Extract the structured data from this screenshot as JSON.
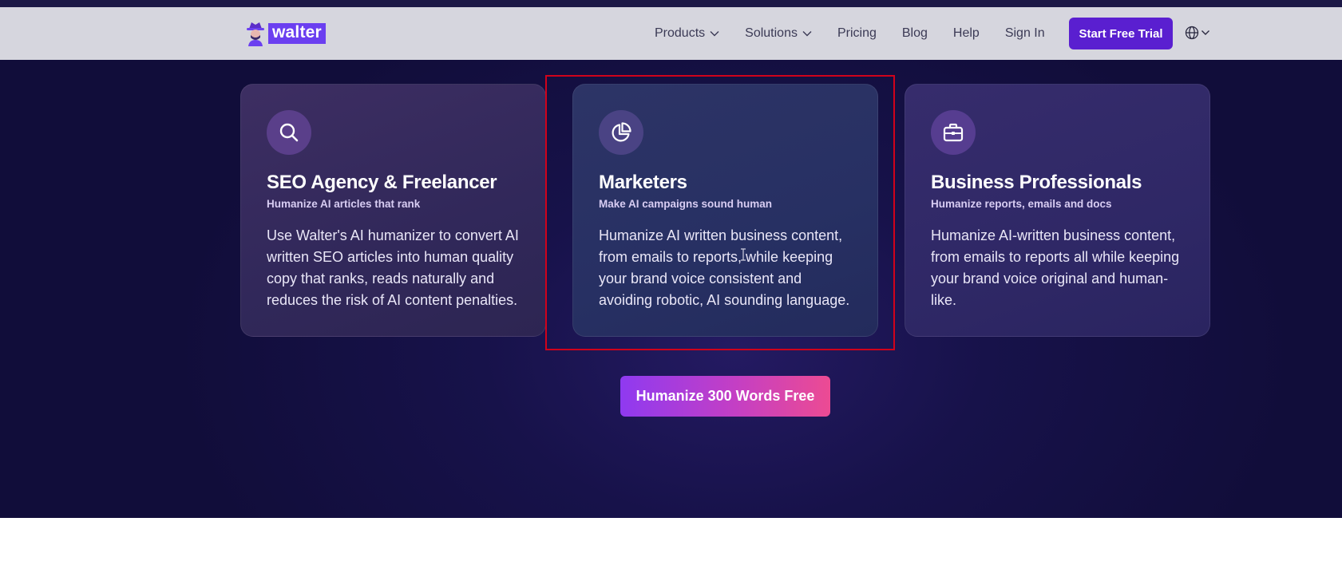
{
  "navbar": {
    "logo_text": "walter",
    "items": [
      {
        "label": "Products",
        "has_dropdown": true
      },
      {
        "label": "Solutions",
        "has_dropdown": true
      },
      {
        "label": "Pricing",
        "has_dropdown": false
      },
      {
        "label": "Blog",
        "has_dropdown": false
      },
      {
        "label": "Help",
        "has_dropdown": false
      },
      {
        "label": "Sign In",
        "has_dropdown": false
      }
    ],
    "cta_label": "Start Free Trial",
    "language_icon": "globe-icon"
  },
  "cards": [
    {
      "icon": "search-icon",
      "title": "SEO Agency & Freelancer",
      "subtitle": "Humanize AI articles that rank",
      "body": "Use Walter's AI humanizer to convert AI written SEO articles into human quality copy that ranks, reads naturally and reduces the risk of AI content penalties."
    },
    {
      "icon": "pie-chart-icon",
      "title": "Marketers",
      "subtitle": "Make AI campaigns sound human",
      "body": "Humanize AI written business content, from emails to reports, while keeping your brand voice consistent and avoiding robotic, AI sounding language."
    },
    {
      "icon": "briefcase-icon",
      "title": "Business Professionals",
      "subtitle": "Humanize reports, emails and docs",
      "body": "Humanize AI-written business content, from emails to reports all while keeping your brand voice original and human-like."
    }
  ],
  "main_cta_label": "Humanize 300 Words Free",
  "colors": {
    "nav_bg": "#d6d6de",
    "hero_bg": "#17124a",
    "accent": "#5a1fd0",
    "highlight_border": "#d0021b",
    "cta_gradient_start": "#8f3af0",
    "cta_gradient_end": "#ec4b93"
  }
}
